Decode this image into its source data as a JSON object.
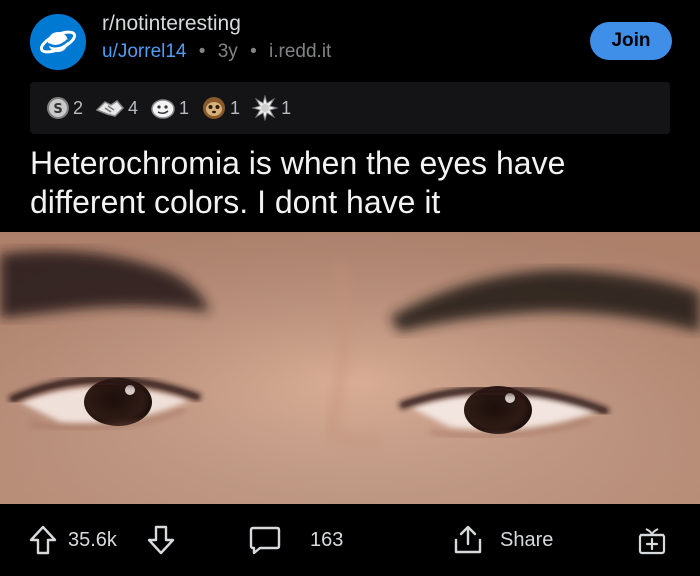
{
  "post": {
    "subreddit": "r/notinteresting",
    "author": "u/Jorrel14",
    "sep1": "•",
    "age": "3y",
    "sep2": "•",
    "domain": "i.redd.it",
    "join_label": "Join",
    "title": "Heterochromia is when the eyes have different colors. I dont have it"
  },
  "awards": [
    {
      "icon": "silver-award-icon",
      "count": "2"
    },
    {
      "icon": "handshake-award-icon",
      "count": "4"
    },
    {
      "icon": "face-award-icon",
      "count": "1"
    },
    {
      "icon": "sloth-award-icon",
      "count": "1"
    },
    {
      "icon": "burst-award-icon",
      "count": "1"
    }
  ],
  "actions": {
    "votes": "35.6k",
    "comments": "163",
    "share_label": "Share"
  },
  "colors": {
    "background": "#000000",
    "accent": "#3f8fe8",
    "username": "#4f9cf7",
    "subreddit_icon": "#0079d3"
  }
}
